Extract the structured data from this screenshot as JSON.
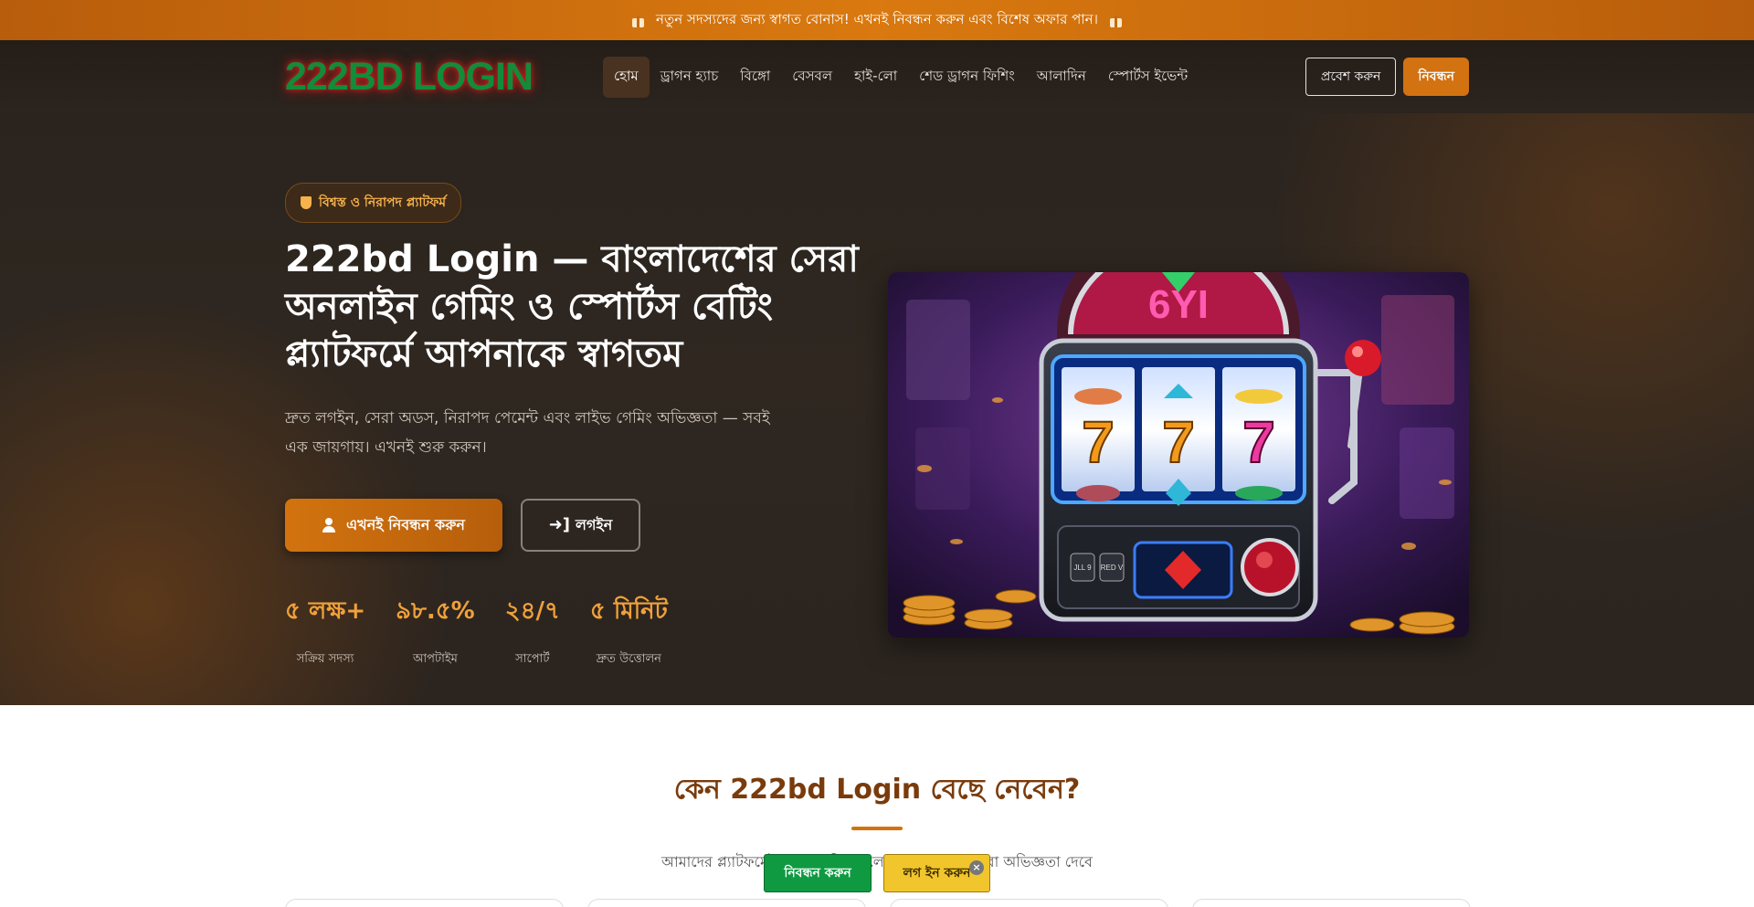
{
  "announcement": {
    "text": "নতুন সদস্যদের জন্য স্বাগত বোনাস! এখনই নিবন্ধন করুন এবং বিশেষ অফার পান।"
  },
  "brand": {
    "logo_text": "222BD LOGIN",
    "accent": "#d2730f",
    "logo_color": "#128c3a"
  },
  "nav": {
    "items": [
      {
        "label": "হোম",
        "active": true
      },
      {
        "label": "ড্রাগন হ্যাচ"
      },
      {
        "label": "বিঙ্গো"
      },
      {
        "label": "বেসবল"
      },
      {
        "label": "হাই-লো"
      },
      {
        "label": "শেড ড্রাগন ফিশিং"
      },
      {
        "label": "আলাদিন"
      },
      {
        "label": "স্পোর্টস ইভেন্ট"
      }
    ],
    "login_label": "প্রবেশ করুন",
    "register_label": "নিবন্ধন"
  },
  "hero": {
    "badge": "বিশ্বস্ত ও নিরাপদ প্ল্যাটফর্ম",
    "title": "222bd Login — বাংলাদেশের সেরা অনলাইন গেমিং ও স্পোর্টস বেটিং প্ল্যাটফর্মে আপনাকে স্বাগতম",
    "subtitle": "দ্রুত লগইন, সেরা অডস, নিরাপদ পেমেন্ট এবং লাইভ গেমিং অভিজ্ঞতা — সবই এক জায়গায়। এখনই শুরু করুন।",
    "primary_cta": "এখনই নিবন্ধন করুন",
    "secondary_cta": "লগইন",
    "stats": [
      {
        "value": "৫ লক্ষ+",
        "label": "সক্রিয় সদস্য"
      },
      {
        "value": "৯৮.৫%",
        "label": "আপটাইম"
      },
      {
        "value": "২৪/৭",
        "label": "সাপোর্ট"
      },
      {
        "value": "৫ মিনিট",
        "label": "দ্রুত উত্তোলন"
      }
    ],
    "slot_reels": [
      "7",
      "7",
      "7"
    ],
    "slot_small_buttons": [
      "JLL 9",
      "RED V"
    ]
  },
  "why": {
    "title": "কেন 222bd Login বেছে নেবেন?",
    "subtitle": "আমাদের প্ল্যাটফর্মের অনন্য সুবিধাগুলো যা আপনাকে সেরা অভিজ্ঞতা দেবে"
  },
  "sticky": {
    "register_label": "নিবন্ধন করুন",
    "login_label": "লগ ইন করুন",
    "close_glyph": "×"
  }
}
